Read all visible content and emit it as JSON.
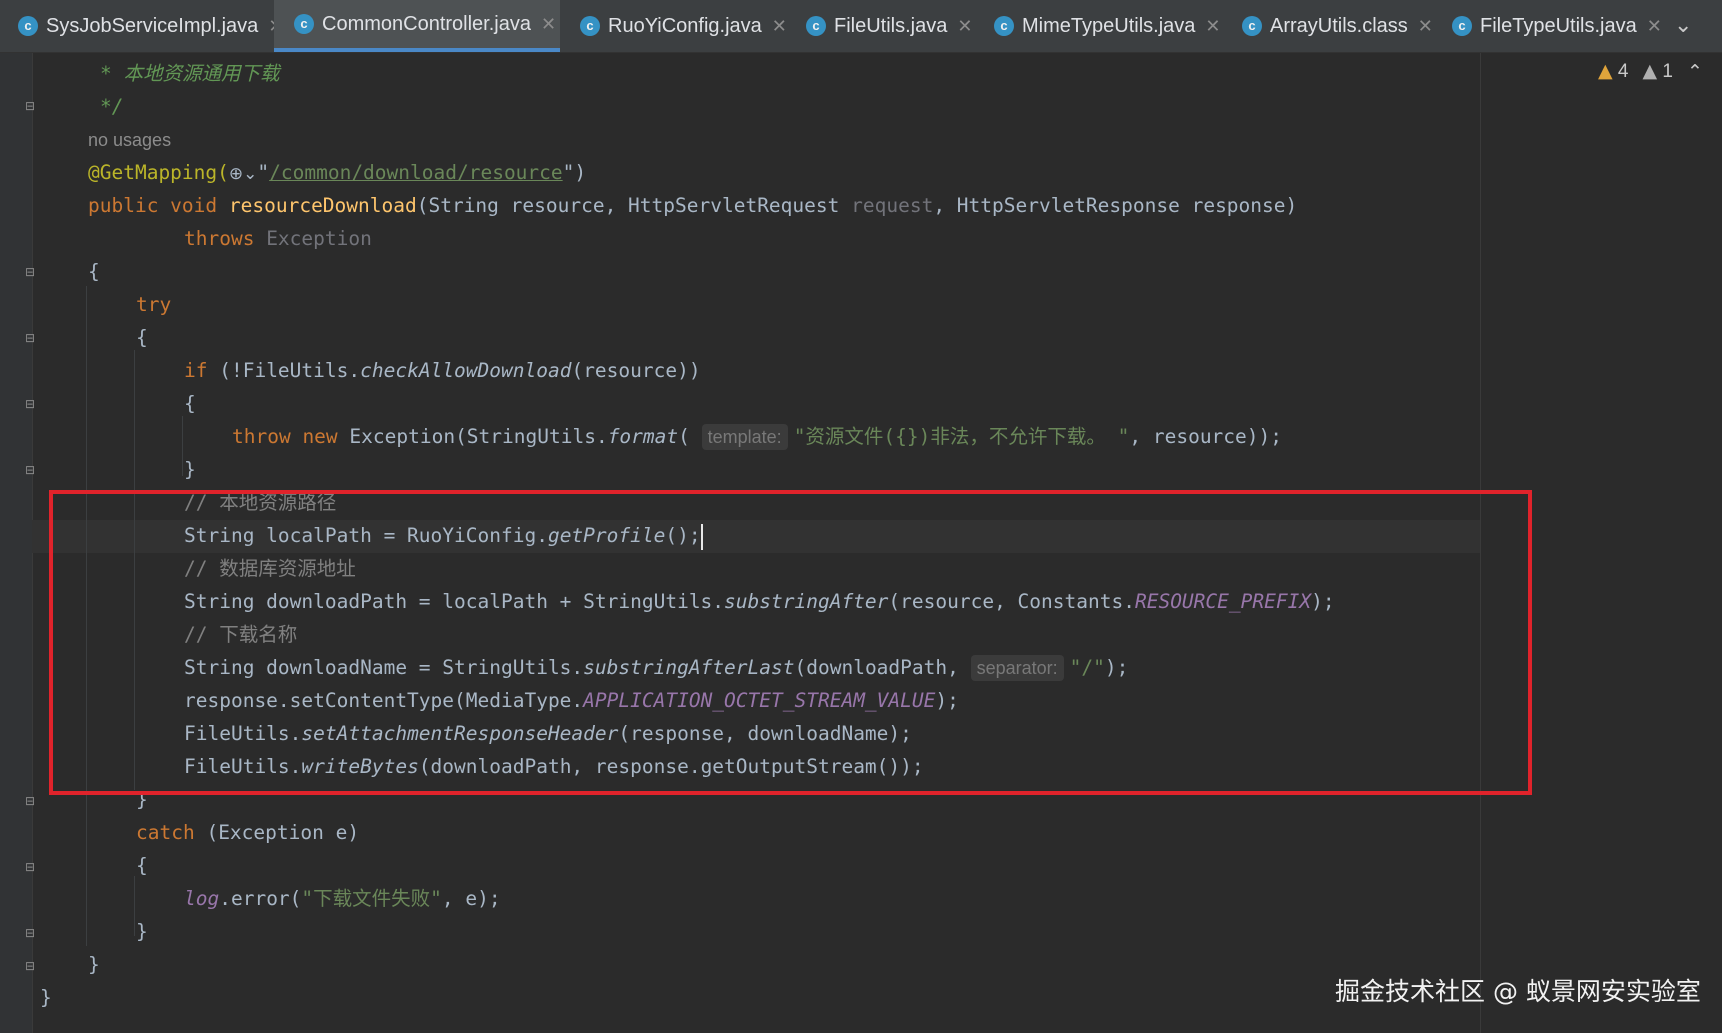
{
  "tabs": [
    {
      "label": "SysJobServiceImpl.java",
      "active": false
    },
    {
      "label": "CommonController.java",
      "active": true
    },
    {
      "label": "RuoYiConfig.java",
      "active": false
    },
    {
      "label": "FileUtils.java",
      "active": false
    },
    {
      "label": "MimeTypeUtils.java",
      "active": false
    },
    {
      "label": "ArrayUtils.class",
      "active": false
    },
    {
      "label": "FileTypeUtils.java",
      "active": false
    }
  ],
  "tab_icon_letter": "c",
  "inspections": {
    "warnings": "4",
    "weak_warnings": "1"
  },
  "code": {
    "l1": "* 本地资源通用下载",
    "l2": "*/",
    "usages": "no usages",
    "l4_ann": "@GetMapping(",
    "l4_url": "/common/download/resource",
    "l5_a": "public void ",
    "l5_fn": "resourceDownload",
    "l5_b": "(String resource, HttpServletRequest ",
    "l5_req": "request",
    "l5_c": ", HttpServletResponse response)",
    "l6_kw": "throws ",
    "l6_ex": "Exception",
    "brace_open": "{",
    "brace_close": "}",
    "try": "try",
    "l10_kw": "if ",
    "l10_a": "(!FileUtils.",
    "l10_m": "checkAllowDownload",
    "l10_b": "(resource))",
    "l12_kw": "throw new ",
    "l12_a": "Exception(StringUtils.",
    "l12_m": "format",
    "l12_paren": "(",
    "hint_template": "template:",
    "l12_str": "\"资源文件({})非法，不允许下载。 \"",
    "l12_b": ", resource));",
    "c1": "// 本地资源路径",
    "l15": "String localPath = RuoYiConfig.",
    "l15_m": "getProfile",
    "l15_end": "();",
    "c2": "// 数据库资源地址",
    "l17_a": "String downloadPath = localPath + StringUtils.",
    "l17_m": "substringAfter",
    "l17_b": "(resource, Constants.",
    "l17_c": "RESOURCE_PREFIX",
    "l17_end": ");",
    "c3": "// 下载名称",
    "l19_a": "String downloadName = StringUtils.",
    "l19_m": "substringAfterLast",
    "l19_b": "(downloadPath, ",
    "hint_separator": "separator:",
    "l19_str": "\"/\"",
    "l19_end": ");",
    "l20_a": "response.setContentType(MediaType.",
    "l20_c": "APPLICATION_OCTET_STREAM_VALUE",
    "l20_end": ");",
    "l21_a": "FileUtils.",
    "l21_m": "setAttachmentResponseHeader",
    "l21_b": "(response, downloadName);",
    "l22_a": "FileUtils.",
    "l22_m": "writeBytes",
    "l22_b": "(downloadPath, response.getOutputStream());",
    "catch_kw": "catch ",
    "catch_b": "(Exception e)",
    "l26_log": "log",
    "l26_a": ".error(",
    "l26_str": "\"下载文件失败\"",
    "l26_b": ", e);"
  },
  "watermark": "掘金技术社区 @ 蚁景网安实验室"
}
